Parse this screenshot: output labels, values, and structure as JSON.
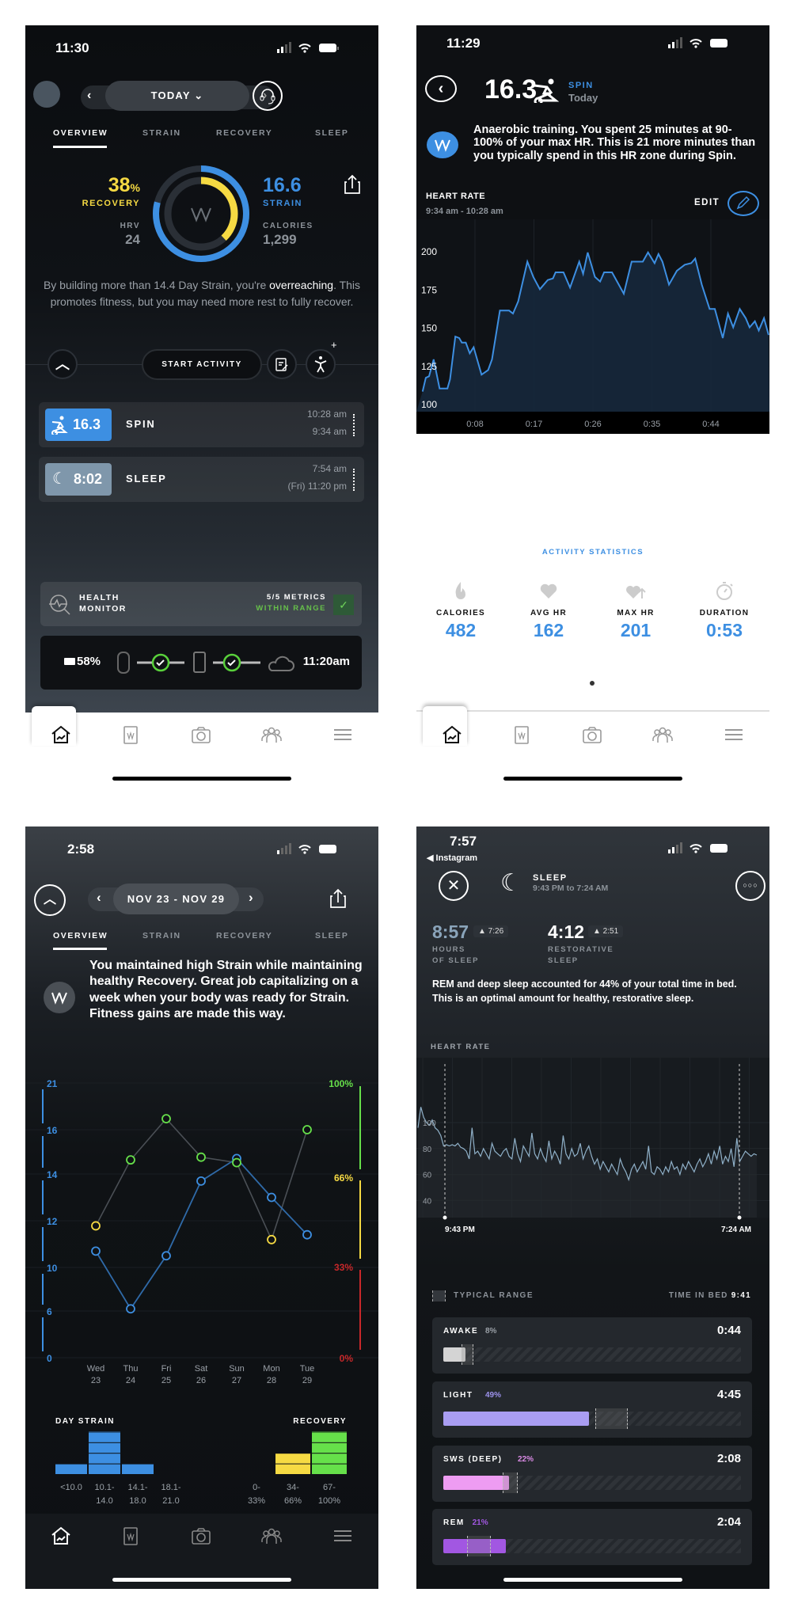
{
  "colors": {
    "blue": "#3d8fe2",
    "yellow": "#f6da43",
    "green": "#66e04a",
    "red": "#c8282a",
    "awake": "#d4d4d4",
    "light": "#a99df2",
    "deep": "#ee9cf2",
    "rem": "#a257e2"
  },
  "overview": {
    "status_time": "11:30",
    "date_label": "TODAY",
    "tabs": [
      "OVERVIEW",
      "STRAIN",
      "RECOVERY",
      "SLEEP"
    ],
    "recovery": {
      "value": "38",
      "unit": "%",
      "label": "RECOVERY",
      "fraction": 0.38
    },
    "hrv": {
      "label": "HRV",
      "value": "24"
    },
    "strain": {
      "value": "16.6",
      "label": "STRAIN",
      "fraction": 0.79
    },
    "calories": {
      "label": "CALORIES",
      "value": "1,299"
    },
    "message": {
      "before": "By building more than 14.4 Day Strain, you're ",
      "highlight": "overreaching",
      "after": ". This promotes fitness, but you may need more rest to fully recover."
    },
    "start_activity": "START ACTIVITY",
    "activities": [
      {
        "value": "16.3",
        "name": "SPIN",
        "end": "10:28 am",
        "start": "9:34 am"
      },
      {
        "value": "8:02",
        "name": "SLEEP",
        "end": "7:54 am",
        "start": "(Fri) 11:20 pm"
      }
    ],
    "health_monitor": {
      "line1": "HEALTH",
      "line2": "MONITOR",
      "metrics": "5/5 METRICS",
      "status": "WITHIN RANGE"
    },
    "device": {
      "battery": "58%",
      "sync_time": "11:20am"
    }
  },
  "spin": {
    "status_time": "11:29",
    "strain": "16.3",
    "activity": "SPIN",
    "day": "Today",
    "message": "Anaerobic training. You spent 25 minutes at 90-100% of your max HR. This is 21 more minutes than you typically spend in this HR zone during Spin.",
    "chart_title": "HEART RATE",
    "chart_range": "9:34 am - 10:28 am",
    "edit_label": "EDIT",
    "stats_title": "ACTIVITY STATISTICS",
    "stats": [
      {
        "label": "CALORIES",
        "value": "482",
        "icon": "flame-icon"
      },
      {
        "label": "AVG HR",
        "value": "162",
        "icon": "heart-icon"
      },
      {
        "label": "MAX HR",
        "value": "201",
        "icon": "heart-up-icon"
      },
      {
        "label": "DURATION",
        "value": "0:53",
        "icon": "stopwatch-icon"
      }
    ]
  },
  "weekly": {
    "status_time": "2:58",
    "date_range": "NOV 23 - NOV 29",
    "tabs": [
      "OVERVIEW",
      "STRAIN",
      "RECOVERY",
      "SLEEP"
    ],
    "message": "You maintained high Strain while maintaining healthy Recovery. Great job capitalizing on a week when your body was ready for Strain. Fitness gains are made this way.",
    "strain_hist_title": "DAY STRAIN",
    "recovery_hist_title": "RECOVERY"
  },
  "sleep": {
    "status_time": "7:57",
    "back_app": "◀ Instagram",
    "title": "SLEEP",
    "time_range": "9:43 PM to 7:24 AM",
    "hours": {
      "value": "8:57",
      "delta": "▲ 7:26",
      "line1": "HOURS",
      "line2": "OF SLEEP"
    },
    "restorative": {
      "value": "4:12",
      "delta": "▲ 2:51",
      "line1": "RESTORATIVE",
      "line2": "SLEEP"
    },
    "message": "REM and deep sleep accounted for 44% of your total time in bed. This is an optimal amount for healthy, restorative sleep.",
    "chart_title": "HEART RATE",
    "typical_range": "TYPICAL RANGE",
    "time_in_bed_label": "TIME IN BED",
    "time_in_bed": "9:41",
    "stages": [
      {
        "name": "AWAKE",
        "pct": "8%",
        "duration": "0:44",
        "fraction": 0.075,
        "typical": [
          0.06,
          0.1
        ],
        "color": "#d4d4d4",
        "pct_color": "#9aa0a7"
      },
      {
        "name": "LIGHT",
        "pct": "49%",
        "duration": "4:45",
        "fraction": 0.49,
        "typical": [
          0.51,
          0.62
        ],
        "color": "#a99df2",
        "pct_color": "#9d92ec"
      },
      {
        "name": "SWS (DEEP)",
        "pct": "22%",
        "duration": "2:08",
        "fraction": 0.22,
        "typical": [
          0.2,
          0.25
        ],
        "color": "#ee9cf2",
        "pct_color": "#d98ae4"
      },
      {
        "name": "REM",
        "pct": "21%",
        "duration": "2:04",
        "fraction": 0.21,
        "typical": [
          0.08,
          0.16
        ],
        "color": "#a257e2",
        "pct_color": "#a257e2"
      }
    ]
  },
  "chart_data": [
    {
      "type": "area",
      "title": "HEART RATE",
      "xlabel": "",
      "ylabel": "",
      "x_ticks": [
        "0:08",
        "0:17",
        "0:26",
        "0:35",
        "0:44"
      ],
      "y_ticks": [
        100,
        125,
        150,
        175,
        200
      ],
      "ylim": [
        100,
        200
      ],
      "x_unit": "minutes",
      "x": [
        0,
        0.5,
        1,
        1.7,
        2.6,
        3.8,
        4.2,
        5,
        5.6,
        6,
        6.6,
        7.2,
        7.8,
        9,
        10,
        10.6,
        11.8,
        13.2,
        13.8,
        14.6,
        16,
        16.9,
        17.9,
        19.1,
        19.9,
        20.3,
        21.5,
        22.5,
        23.9,
        24.5,
        25.2,
        26.3,
        27.1,
        27.7,
        28.9,
        30.7,
        31.9,
        32.8,
        33.6,
        34.4,
        35.4,
        36,
        36.6,
        37.6,
        38.8,
        40,
        41,
        41.6,
        42.6,
        43.8,
        44.6,
        45.8,
        46.6,
        47.4,
        48.4,
        49.3,
        49.9,
        50.7,
        51.3,
        52.1,
        52.8
      ],
      "y": [
        108,
        117,
        118,
        129,
        110,
        110,
        116,
        144,
        143,
        140,
        140,
        133,
        137,
        119,
        122,
        129,
        161,
        161,
        159,
        167,
        193,
        183,
        175,
        181,
        182,
        186,
        186,
        176,
        193,
        185,
        199,
        183,
        180,
        186,
        186,
        172,
        193,
        193,
        193,
        199,
        192,
        198,
        193,
        178,
        187,
        191,
        192,
        195,
        178,
        162,
        162,
        143,
        159,
        150,
        162,
        156,
        150,
        154,
        148,
        156,
        145
      ]
    },
    {
      "type": "line",
      "categories": [
        "Wed 23",
        "Thu 24",
        "Fri 25",
        "Sat 26",
        "Sun 27",
        "Mon 28",
        "Tue 29"
      ],
      "day_names": [
        "Wed",
        "Thu",
        "Fri",
        "Sat",
        "Sun",
        "Mon",
        "Tue"
      ],
      "day_nums": [
        "23",
        "24",
        "25",
        "26",
        "27",
        "28",
        "29"
      ],
      "series": [
        {
          "axis": "left",
          "values": [
            10.7,
            6.2,
            10.5,
            13.7,
            14.7,
            13.0,
            11.4
          ]
        },
        {
          "axis": "right",
          "values": [
            48,
            72,
            87,
            73,
            71,
            43,
            83
          ]
        }
      ],
      "left_ticks": [
        "21",
        "16",
        "14",
        "12",
        "10",
        "6",
        "0"
      ],
      "right_ticks": [
        "100%",
        "66%",
        "33%",
        "0%"
      ],
      "left_ylim": [
        0,
        21
      ],
      "right_ylim": [
        0,
        100
      ]
    },
    {
      "type": "bar",
      "title": "DAY STRAIN",
      "categories": [
        [
          "<10.0",
          ""
        ],
        [
          "10.1-",
          "14.0"
        ],
        [
          "14.1-",
          "18.0"
        ],
        [
          "18.1-",
          "21.0"
        ]
      ],
      "values": [
        1,
        5,
        1,
        0
      ]
    },
    {
      "type": "bar",
      "title": "RECOVERY",
      "categories": [
        [
          "0-",
          "33%"
        ],
        [
          "34-",
          "66%"
        ],
        [
          "67-",
          "100%"
        ]
      ],
      "values": [
        0,
        2,
        5
      ]
    },
    {
      "type": "line",
      "title": "HEART RATE",
      "y_ticks": [
        40,
        60,
        80,
        100
      ],
      "x_ticks": [
        "9:43 PM",
        "7:24 AM"
      ],
      "y": [
        96,
        112,
        104,
        100,
        98,
        102,
        96,
        94,
        90,
        82,
        83,
        82,
        83,
        82,
        84,
        81,
        80,
        78,
        72,
        96,
        76,
        78,
        74,
        80,
        76,
        72,
        84,
        78,
        76,
        74,
        78,
        80,
        74,
        72,
        88,
        76,
        70,
        82,
        78,
        74,
        92,
        76,
        72,
        80,
        74,
        70,
        86,
        72,
        78,
        74,
        68,
        90,
        76,
        72,
        80,
        74,
        76,
        84,
        72,
        78,
        82,
        74,
        68,
        72,
        64,
        70,
        66,
        62,
        68,
        64,
        60,
        72,
        66,
        62,
        56,
        64,
        68,
        62,
        66,
        70,
        64,
        82,
        62,
        60,
        66,
        64,
        60,
        66,
        62,
        70,
        64,
        66,
        60,
        68,
        64,
        70,
        66,
        62,
        68,
        72,
        66,
        70,
        76,
        68,
        78,
        72,
        82,
        68,
        74,
        70,
        80,
        66,
        88,
        70,
        74,
        78,
        76,
        74,
        76,
        75
      ]
    }
  ]
}
